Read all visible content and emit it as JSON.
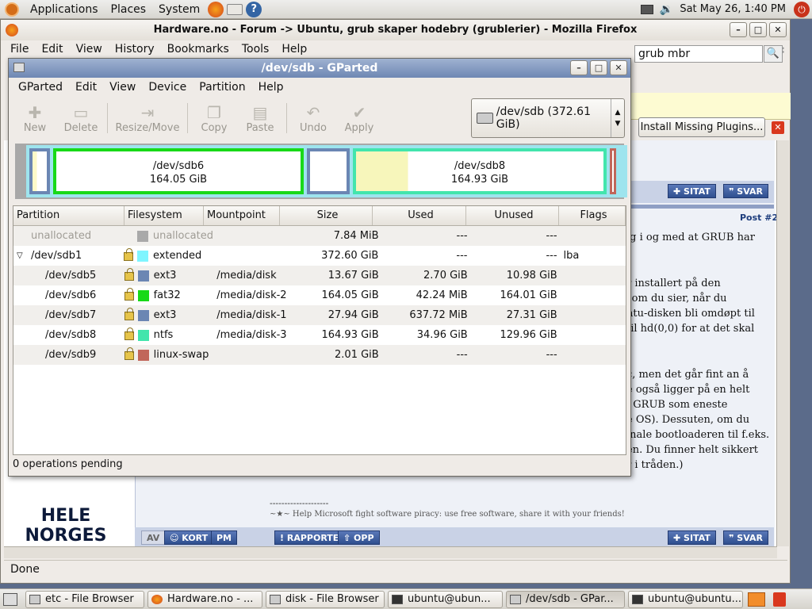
{
  "top_panel": {
    "menus": [
      "Applications",
      "Places",
      "System"
    ],
    "clock": "Sat May 26,  1:40 PM"
  },
  "firefox": {
    "title": "Hardware.no - Forum -> Ubuntu, grub skaper hodebry (grublerier) - Mozilla Firefox",
    "menus": [
      "File",
      "Edit",
      "View",
      "History",
      "Bookmarks",
      "Tools",
      "Help"
    ],
    "search_value": "grub mbr",
    "plugin_button": "Install Missing Plugins...",
    "status": "Done",
    "forum": {
      "buttons": {
        "sitat": "SITAT",
        "svar": "SVAR",
        "av": "AV",
        "kort": "KORT",
        "pm": "PM",
        "rapporter": "RAPPORTER",
        "opp": "OPP"
      },
      "post_number": "Post #2",
      "lines": [
        "ig i og med at GRUB har",
        "r installert på den",
        " som du sier, når du",
        "ntu-disken bli omdøpt til",
        " til hd(0,0) for at det skal",
        "c, men det går fint an å",
        "e også ligger på en helt",
        "l GRUB som eneste",
        "e OS). Dessuten, om du",
        "inale bootloaderen til f.eks.",
        "en. Du finner helt sikkert",
        "r i tråden.)"
      ],
      "sig_rule": "--------------------",
      "sig_text": "~★~ Help Microsoft fight software piracy: use free software, share it with your friends!",
      "ad_lines": [
        "HELE",
        "NORGES"
      ]
    }
  },
  "gparted": {
    "title": "/dev/sdb - GParted",
    "menus": [
      "GParted",
      "Edit",
      "View",
      "Device",
      "Partition",
      "Help"
    ],
    "toolbar": [
      "New",
      "Delete",
      "Resize/Move",
      "Copy",
      "Paste",
      "Undo",
      "Apply"
    ],
    "device": "/dev/sdb   (372.61 GiB)",
    "graph": {
      "sdb6": {
        "name": "/dev/sdb6",
        "size": "164.05 GiB"
      },
      "sdb8": {
        "name": "/dev/sdb8",
        "size": "164.93 GiB"
      }
    },
    "columns": [
      "Partition",
      "Filesystem",
      "Mountpoint",
      "Size",
      "Used",
      "Unused",
      "Flags"
    ],
    "rows": [
      {
        "partition": "unallocated",
        "filesystem": "unallocated",
        "mountpoint": "",
        "size": "7.84 MiB",
        "used": "---",
        "unused": "---",
        "flags": "",
        "color": "#a9a9a9"
      },
      {
        "partition": "/dev/sdb1",
        "filesystem": "extended",
        "mountpoint": "",
        "size": "372.60 GiB",
        "used": "---",
        "unused": "---",
        "flags": "lba",
        "color": "#7ff5ff"
      },
      {
        "partition": "/dev/sdb5",
        "filesystem": "ext3",
        "mountpoint": "/media/disk",
        "size": "13.67 GiB",
        "used": "2.70 GiB",
        "unused": "10.98 GiB",
        "flags": "",
        "color": "#6b86b3"
      },
      {
        "partition": "/dev/sdb6",
        "filesystem": "fat32",
        "mountpoint": "/media/disk-2",
        "size": "164.05 GiB",
        "used": "42.24 MiB",
        "unused": "164.01 GiB",
        "flags": "",
        "color": "#18d918"
      },
      {
        "partition": "/dev/sdb7",
        "filesystem": "ext3",
        "mountpoint": "/media/disk-1",
        "size": "27.94 GiB",
        "used": "637.72 MiB",
        "unused": "27.31 GiB",
        "flags": "",
        "color": "#6b86b3"
      },
      {
        "partition": "/dev/sdb8",
        "filesystem": "ntfs",
        "mountpoint": "/media/disk-3",
        "size": "164.93 GiB",
        "used": "34.96 GiB",
        "unused": "129.96 GiB",
        "flags": "",
        "color": "#42e5ac"
      },
      {
        "partition": "/dev/sdb9",
        "filesystem": "linux-swap",
        "mountpoint": "",
        "size": "2.01 GiB",
        "used": "---",
        "unused": "---",
        "flags": "",
        "color": "#c1665a"
      }
    ],
    "status": "0 operations pending"
  },
  "taskbar": [
    "etc - File Browser",
    "Hardware.no - ...",
    "disk - File Browser",
    "ubuntu@ubun...",
    "/dev/sdb - GPar...",
    "ubuntu@ubuntu..."
  ]
}
